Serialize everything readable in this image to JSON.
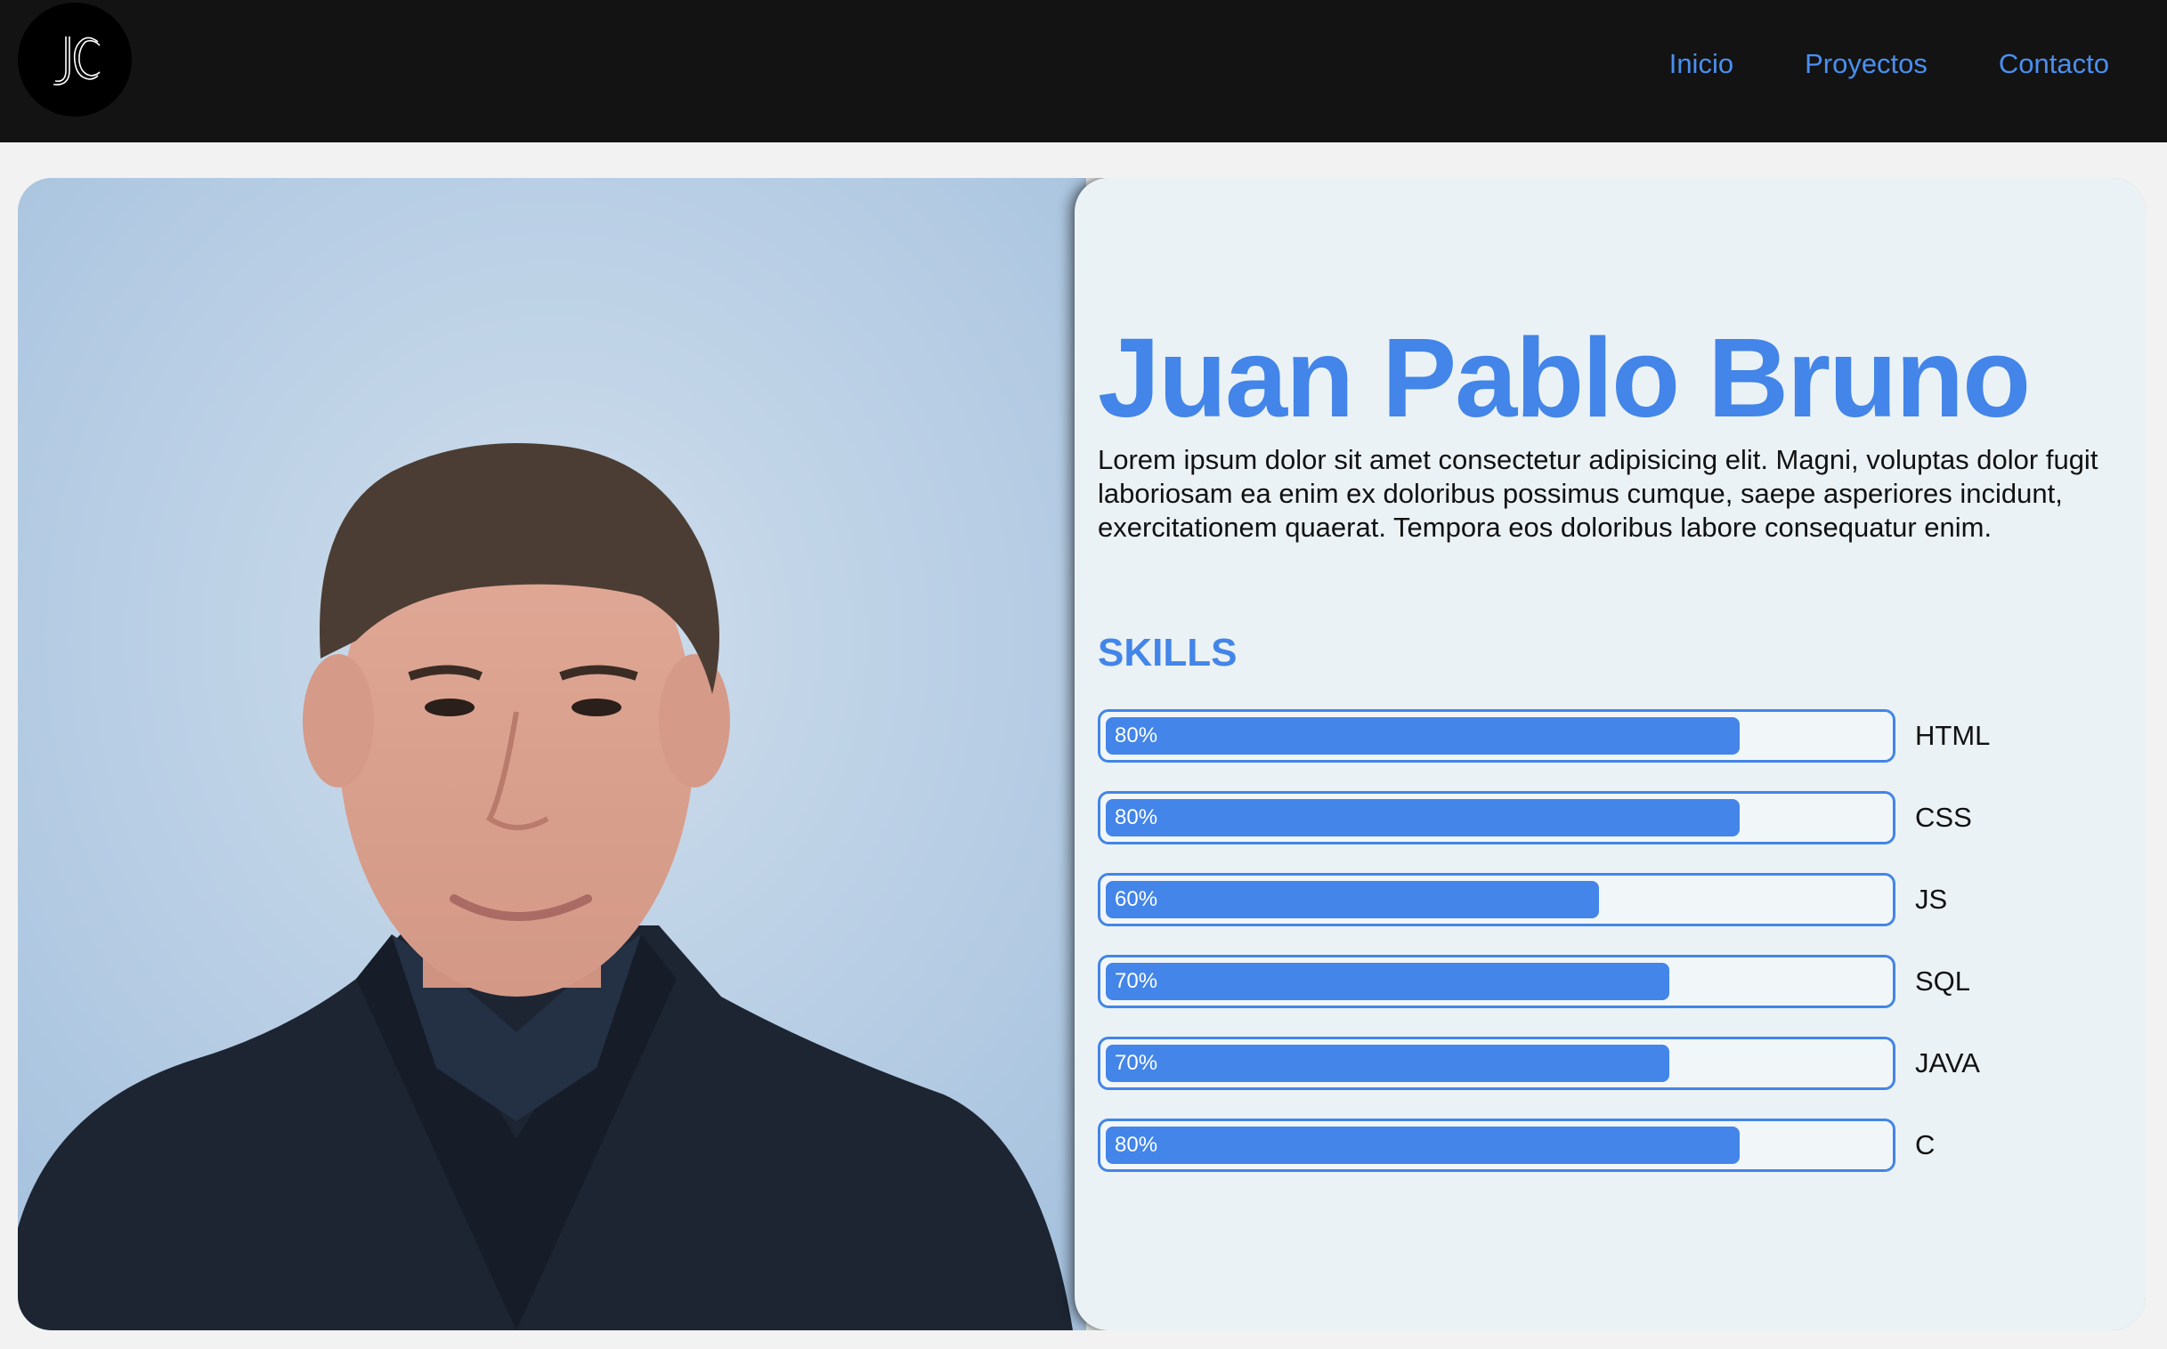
{
  "header": {
    "logo_text": "JC",
    "nav": [
      {
        "label": "Inicio"
      },
      {
        "label": "Proyectos"
      },
      {
        "label": "Contacto"
      }
    ]
  },
  "profile": {
    "name": "Juan Pablo Bruno",
    "bio": "Lorem ipsum dolor sit amet consectetur adipisicing elit. Magni, voluptas dolor fugit laboriosam ea enim ex doloribus possimus cumque, saepe asperiores incidunt, exercitationem quaerat. Tempora eos doloribus labore consequatur enim.",
    "skills_title": "SKILLS",
    "skills": [
      {
        "name": "HTML",
        "percent": 80,
        "label": "80%"
      },
      {
        "name": "CSS",
        "percent": 80,
        "label": "80%"
      },
      {
        "name": "JS",
        "percent": 60,
        "label": "60%"
      },
      {
        "name": "SQL",
        "percent": 70,
        "label": "70%"
      },
      {
        "name": "JAVA",
        "percent": 70,
        "label": "70%"
      },
      {
        "name": "C",
        "percent": 80,
        "label": "80%"
      }
    ]
  },
  "colors": {
    "accent": "#4385e8",
    "nav_link": "#4a8ff0",
    "navbar_bg": "#131313",
    "info_bg": "#ebf2f5"
  }
}
